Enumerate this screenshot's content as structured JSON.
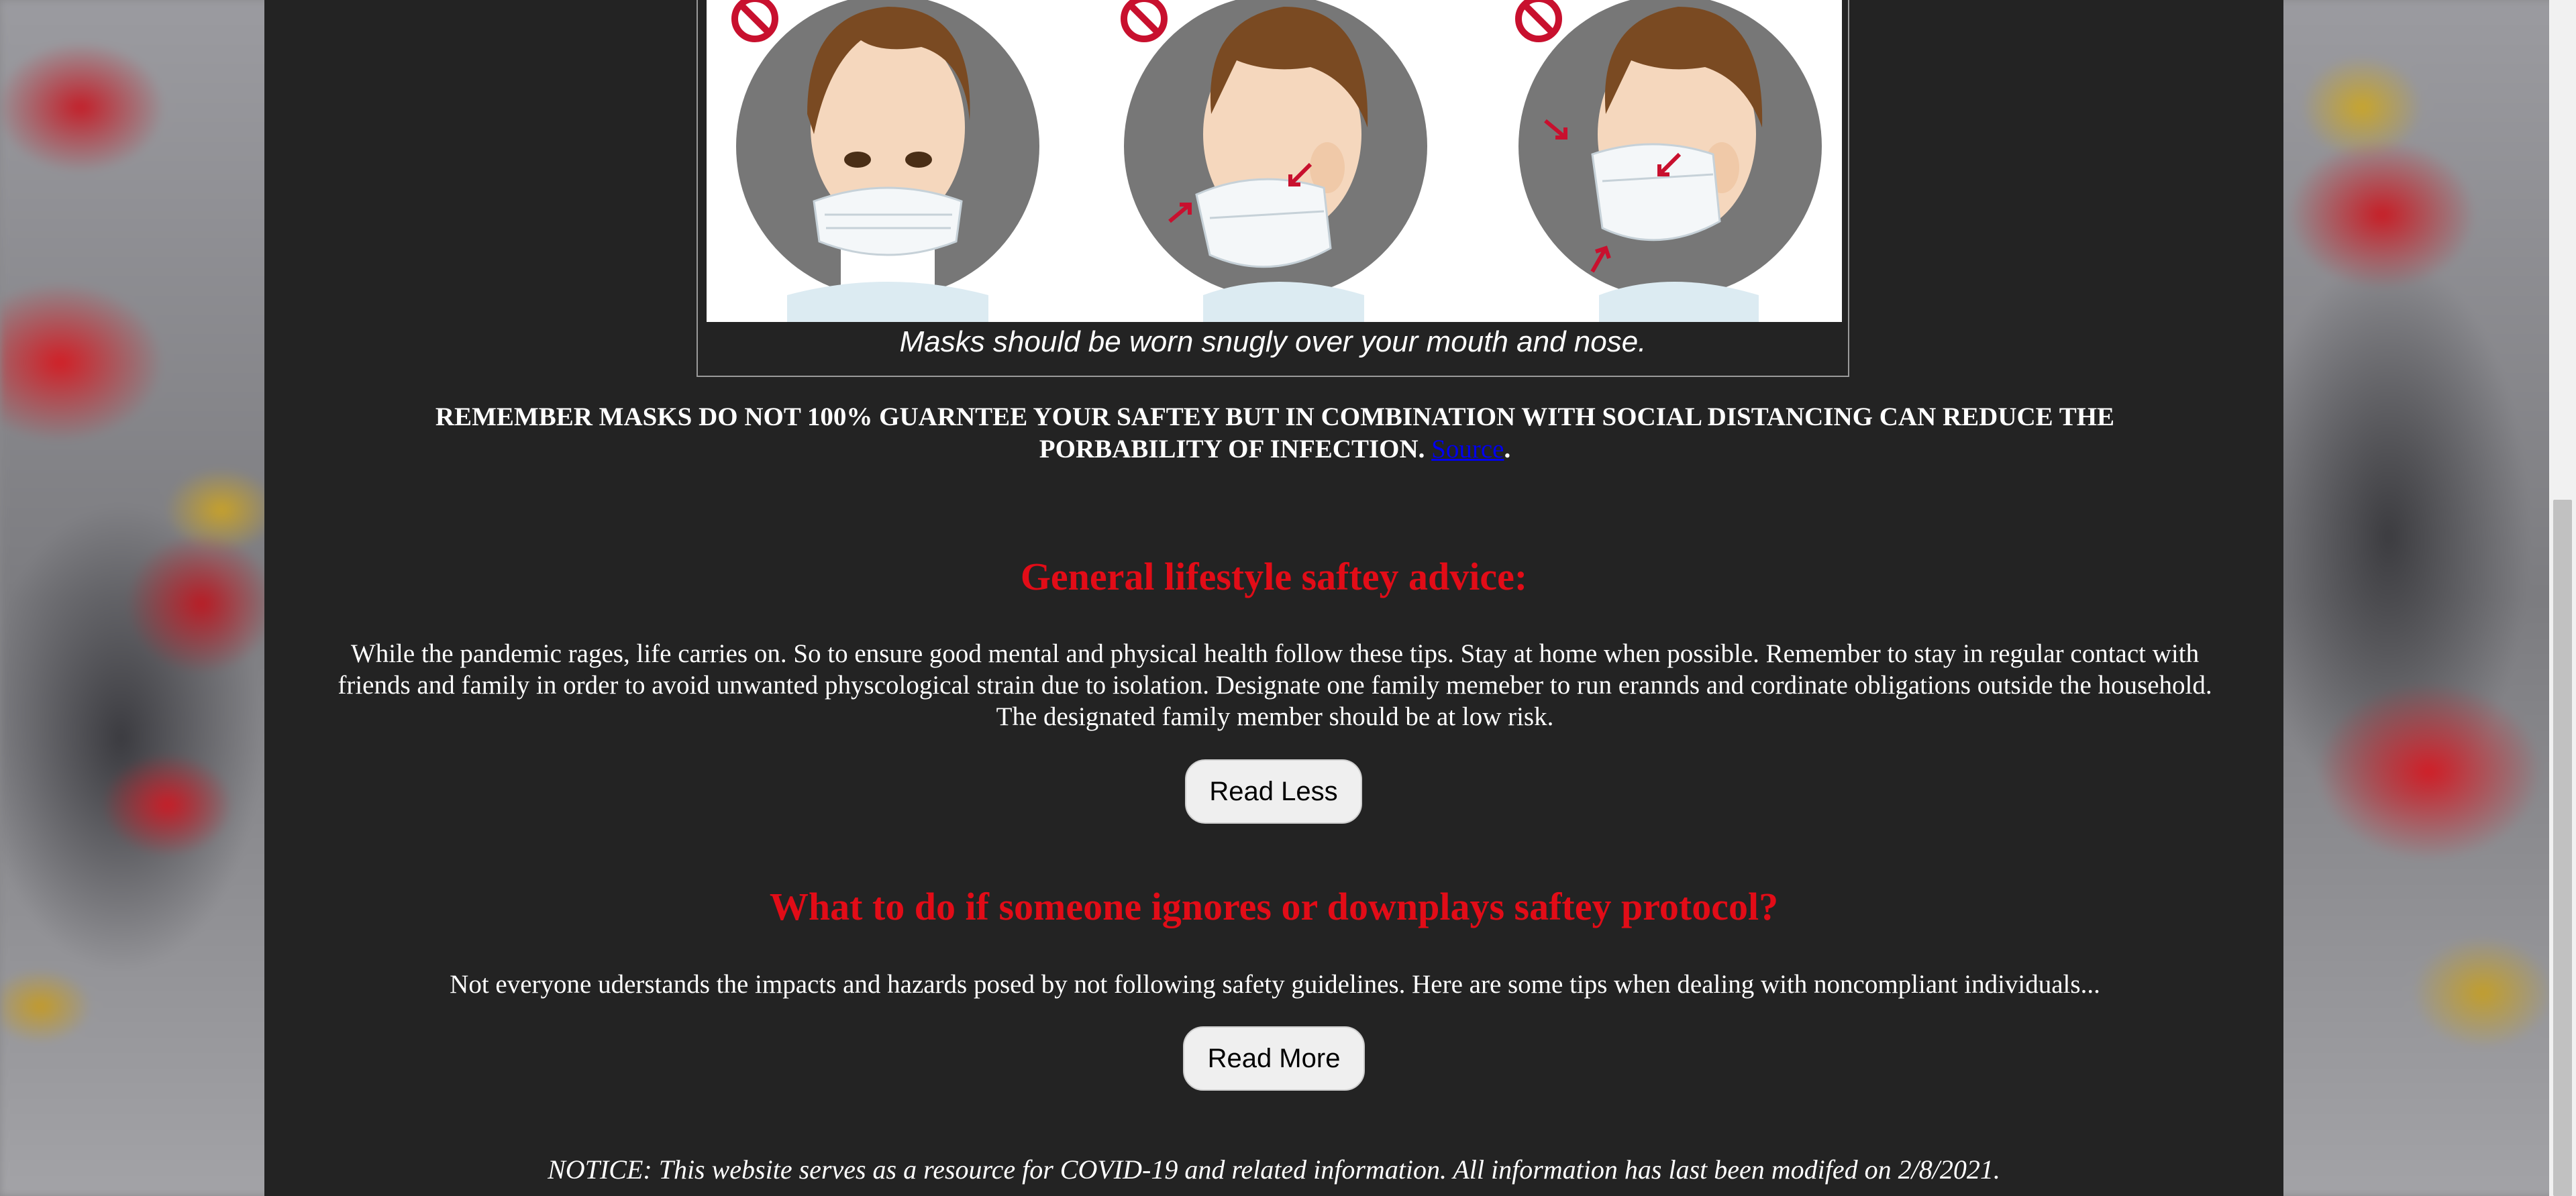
{
  "figure": {
    "caption": "Masks should be worn snugly over your mouth and nose.",
    "illustrations": [
      "mask-under-nose",
      "mask-side-below-nose",
      "mask-side-loose"
    ]
  },
  "warning": {
    "text": "REMEMBER MASKS DO NOT 100% GUARNTEE YOUR SAFTEY BUT IN COMBINATION WITH SOCIAL DISTANCING CAN REDUCE THE PORBABILITY OF INFECTION. ",
    "link_label": "Source",
    "trailing": "."
  },
  "sections": [
    {
      "heading": "General lifestyle saftey advice:",
      "body": "While the pandemic rages, life carries on. So to ensure good mental and physical health follow these tips. Stay at home when possible. Remember to stay in regular contact with friends and family in order to avoid unwanted physcological strain due to isolation. Designate one family memeber to run erannds and cordinate obligations outside the household. The designated family member should be at low risk.",
      "button_label": "Read Less"
    },
    {
      "heading": "What to do if someone ignores or downplays saftey protocol?",
      "body": "Not everyone uderstands the impacts and hazards posed by not following safety guidelines. Here are some tips when dealing with noncompliant individuals...",
      "button_label": "Read More"
    }
  ],
  "notice": "NOTICE: This website serves as a resource for COVID-19 and related information. All information has last been modifed on 2/8/2021.",
  "colors": {
    "panel": "#232323",
    "heading": "#e20c17",
    "link": "#0000ee",
    "prohibited": "#c8102e"
  }
}
